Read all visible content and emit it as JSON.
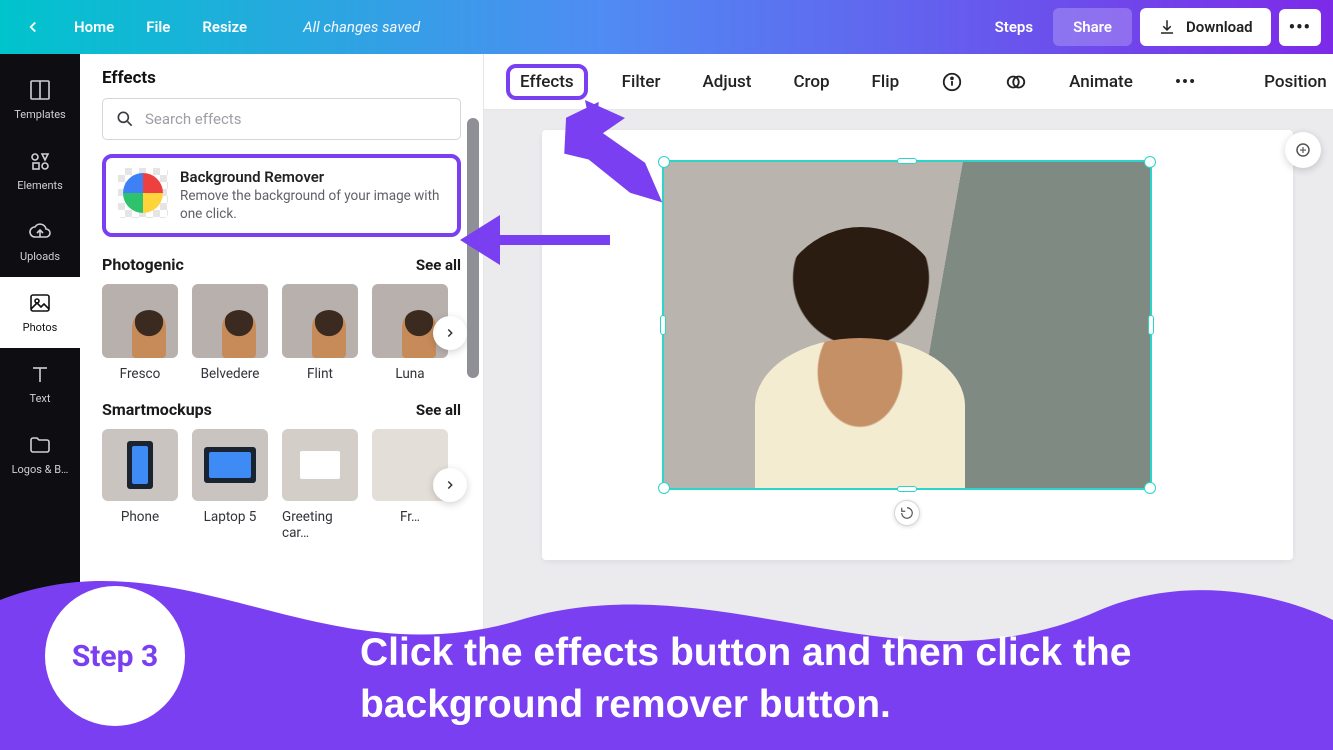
{
  "topbar": {
    "home": "Home",
    "file": "File",
    "resize": "Resize",
    "status": "All changes saved",
    "steps": "Steps",
    "share": "Share",
    "download": "Download"
  },
  "sidebar": {
    "items": [
      {
        "label": "Templates"
      },
      {
        "label": "Elements"
      },
      {
        "label": "Uploads"
      },
      {
        "label": "Photos"
      },
      {
        "label": "Text"
      },
      {
        "label": "Logos & B…"
      }
    ]
  },
  "panel": {
    "title": "Effects",
    "search_placeholder": "Search effects",
    "bg_remover": {
      "title": "Background Remover",
      "desc": "Remove the background of your image with one click."
    },
    "sections": [
      {
        "title": "Photogenic",
        "seeall": "See all",
        "items": [
          "Fresco",
          "Belvedere",
          "Flint",
          "Luna"
        ]
      },
      {
        "title": "Smartmockups",
        "seeall": "See all",
        "items": [
          "Phone",
          "Laptop 5",
          "Greeting car…",
          "Fr…"
        ]
      }
    ]
  },
  "context_toolbar": {
    "effects": "Effects",
    "filter": "Filter",
    "adjust": "Adjust",
    "crop": "Crop",
    "flip": "Flip",
    "animate": "Animate",
    "position": "Position"
  },
  "instruction": {
    "step_label": "Step 3",
    "text": "Click the effects button and then click the background remover button."
  },
  "colors": {
    "accent": "#7b3ff2",
    "selection": "#2dd4c9"
  }
}
